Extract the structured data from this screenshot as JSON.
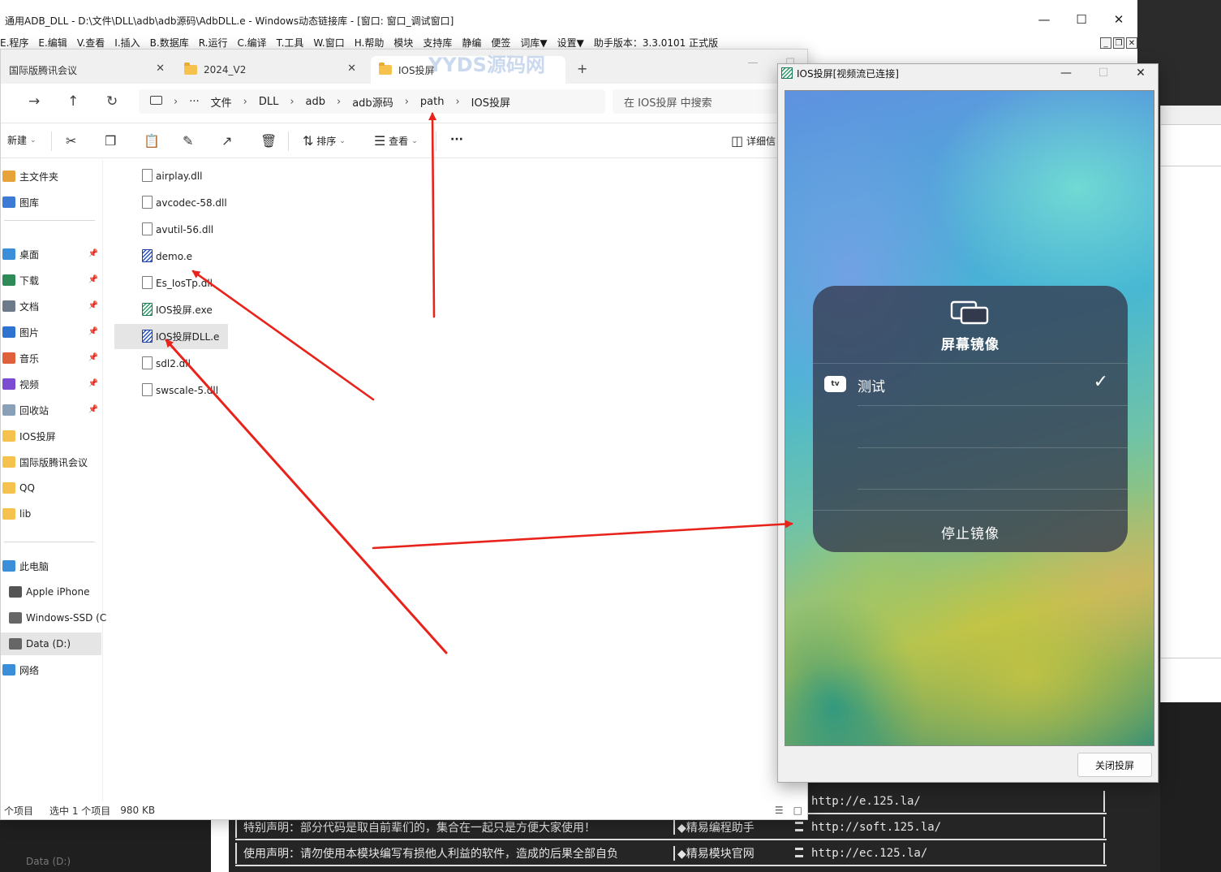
{
  "ide": {
    "title": "通用ADB_DLL - D:\\文件\\DLL\\adb\\adb源码\\AdbDLL.e - Windows动态链接库 - [窗口: 窗口_调试窗口]",
    "menu": [
      "E.程序",
      "E.编辑",
      "V.查看",
      "I.插入",
      "B.数据库",
      "R.运行",
      "C.编译",
      "T.工具",
      "W.窗口",
      "H.帮助",
      "模块",
      "支持库",
      "静编",
      "便签",
      "词库▼",
      "设置▼",
      "助手版本：3.3.0101 正式版"
    ],
    "bottom_left": "Data (D:)"
  },
  "console": {
    "rows": [
      {
        "left": "",
        "mid": "",
        "url": "http://e.125.la/"
      },
      {
        "left": "特别声明：部分代码是取自前辈们的，集合在一起只是方便大家使用！",
        "mid": "◆精易编程助手",
        "url": "http://soft.125.la/"
      },
      {
        "left": "使用声明：请勿使用本模块编写有损他人利益的软件，造成的后果全部自负",
        "mid": "◆精易模块官网",
        "url": "http://ec.125.la/"
      }
    ]
  },
  "explorer": {
    "tabs": [
      {
        "label": "国际版腾讯会议",
        "folder": false
      },
      {
        "label": "2024_V2",
        "folder": true
      },
      {
        "label": "IOS投屏",
        "folder": true
      }
    ],
    "breadcrumbs": [
      "···",
      "文件",
      "DLL",
      "adb",
      "adb源码",
      "path",
      "IOS投屏"
    ],
    "search_placeholder": "在 IOS投屏 中搜索",
    "toolbar": {
      "new": "新建",
      "sort": "排序",
      "view": "查看",
      "more": "···",
      "details": "详细信"
    },
    "sidebar": [
      {
        "label": "主文件夹",
        "color": "#e7a23a",
        "pin": false
      },
      {
        "label": "图库",
        "color": "#3b7bd6",
        "pin": false
      },
      {
        "label": "桌面",
        "color": "#3b8fd9",
        "pin": true
      },
      {
        "label": "下载",
        "color": "#2e8b57",
        "pin": true
      },
      {
        "label": "文档",
        "color": "#6c7a89",
        "pin": true
      },
      {
        "label": "图片",
        "color": "#2f73d1",
        "pin": true
      },
      {
        "label": "音乐",
        "color": "#e0603c",
        "pin": true
      },
      {
        "label": "视频",
        "color": "#7b4bd1",
        "pin": true
      },
      {
        "label": "回收站",
        "color": "#8aa0b8",
        "pin": true
      },
      {
        "label": "IOS投屏",
        "color": "#f4c24d",
        "pin": false
      },
      {
        "label": "国际版腾讯会议",
        "color": "#f4c24d",
        "pin": false
      },
      {
        "label": "QQ",
        "color": "#f4c24d",
        "pin": false
      },
      {
        "label": "lib",
        "color": "#f4c24d",
        "pin": false
      },
      {
        "label": "此电脑",
        "color": "#3b8fd9",
        "pin": false
      },
      {
        "label": "Apple iPhone",
        "color": "#555555",
        "pin": false
      },
      {
        "label": "Windows-SSD (C",
        "color": "#666666",
        "pin": false
      },
      {
        "label": "Data (D:)",
        "color": "#666666",
        "pin": false
      },
      {
        "label": "网络",
        "color": "#3b8fd9",
        "pin": false
      }
    ],
    "files": [
      {
        "name": "airplay.dll",
        "type": "dll"
      },
      {
        "name": "avcodec-58.dll",
        "type": "dll"
      },
      {
        "name": "avutil-56.dll",
        "type": "dll"
      },
      {
        "name": "demo.e",
        "type": "e"
      },
      {
        "name": "Es_IosTp.dll",
        "type": "dll"
      },
      {
        "name": "IOS投屏.exe",
        "type": "exe"
      },
      {
        "name": "IOS投屏DLL.e",
        "type": "e"
      },
      {
        "name": "sdl2.dll",
        "type": "dll"
      },
      {
        "name": "swscale-5.dll",
        "type": "dll"
      }
    ],
    "selected_file": "IOS投屏DLL.e",
    "status": {
      "items": "个项目",
      "selected": "选中 1 个项目",
      "size": "980 KB"
    }
  },
  "mirror": {
    "title": "IOS投屏[视频流已连接]",
    "card": {
      "title": "屏幕镜像",
      "device": "测试",
      "device_badge": "tv",
      "stop": "停止镜像"
    },
    "close_button": "关闭投屏"
  },
  "watermark": "YYDS源码网"
}
